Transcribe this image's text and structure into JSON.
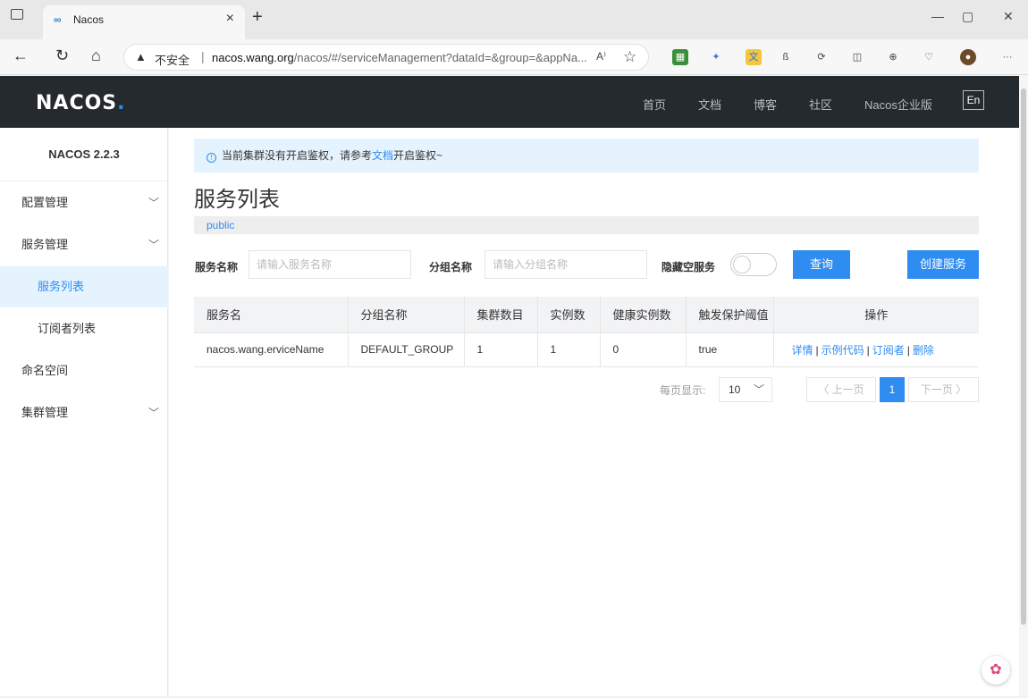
{
  "browser": {
    "tab_title": "Nacos",
    "tab_favicon": "∞",
    "security_label": "不安全",
    "url_host": "nacos.wang.org",
    "url_path": "/nacos/#/serviceManagement?dataId=&group=&appNa...",
    "read_aloud": "A⁾"
  },
  "header": {
    "logo": "NACOS",
    "logo_dot": ".",
    "nav": [
      "首页",
      "文档",
      "博客",
      "社区",
      "Nacos企业版"
    ],
    "lang": "En"
  },
  "sidebar": {
    "version": "NACOS 2.2.3",
    "items": [
      {
        "label": "配置管理"
      },
      {
        "label": "服务管理"
      },
      {
        "label": "服务列表"
      },
      {
        "label": "订阅者列表"
      },
      {
        "label": "命名空间"
      },
      {
        "label": "集群管理"
      }
    ]
  },
  "alert": {
    "text_before": "当前集群没有开启鉴权，请参考",
    "link": "文档",
    "text_after": "开启鉴权~"
  },
  "page": {
    "title": "服务列表",
    "namespace": "public"
  },
  "filters": {
    "service_label": "服务名称",
    "service_placeholder": "请输入服务名称",
    "group_label": "分组名称",
    "group_placeholder": "请输入分组名称",
    "hide_empty_label": "隐藏空服务",
    "query_button": "查询",
    "create_button": "创建服务"
  },
  "table": {
    "headers": [
      "服务名",
      "分组名称",
      "集群数目",
      "实例数",
      "健康实例数",
      "触发保护阈值",
      "操作"
    ],
    "rows": [
      {
        "service": "nacos.wang.erviceName",
        "group": "DEFAULT_GROUP",
        "clusters": "1",
        "instances": "1",
        "healthy": "0",
        "threshold": "true",
        "actions": [
          "详情",
          "示例代码",
          "订阅者",
          "删除"
        ]
      }
    ]
  },
  "pagination": {
    "per_page_label": "每页显示:",
    "per_page": "10",
    "prev": "〈 上一页",
    "current": "1",
    "next": "下一页 〉"
  },
  "colors": {
    "accent": "#2f8cf0",
    "header_bg": "#252a2f"
  }
}
